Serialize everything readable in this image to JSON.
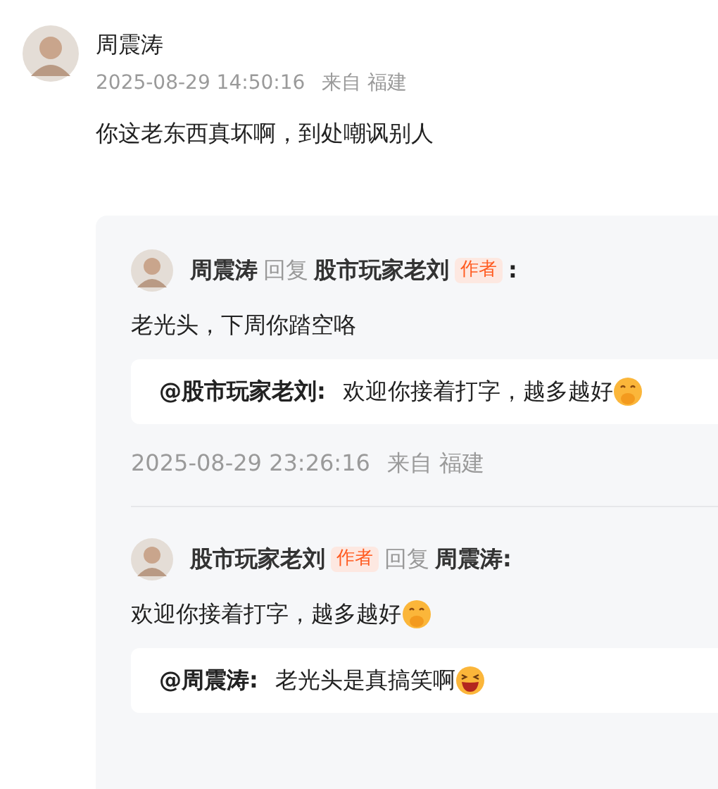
{
  "comment": {
    "author": "周震涛",
    "time": "2025-08-29 14:50:16",
    "location": "来自 福建",
    "content": "你这老东西真坏啊，到处嘲讽别人"
  },
  "replies": [
    {
      "header": [
        {
          "kind": "name",
          "text": "周震涛"
        },
        {
          "kind": "reply",
          "text": "回复"
        },
        {
          "kind": "name",
          "text": "股市玩家老刘"
        },
        {
          "kind": "badge",
          "text": "作者"
        },
        {
          "kind": "colon",
          "text": ":"
        }
      ],
      "content": "老光头，下周你踏空咯",
      "quote": {
        "mention": "@股市玩家老刘:",
        "text": "欢迎你接着打字，越多越好",
        "emoji": {
          "kind": "shy"
        }
      },
      "time": "2025-08-29 23:26:16",
      "location": "来自 福建"
    },
    {
      "header": [
        {
          "kind": "name",
          "text": "股市玩家老刘"
        },
        {
          "kind": "badge",
          "text": "作者"
        },
        {
          "kind": "reply",
          "text": "回复"
        },
        {
          "kind": "name",
          "text": "周震涛:"
        }
      ],
      "content": "欢迎你接着打字，越多越好",
      "content_emoji": {
        "kind": "shy"
      },
      "quote": {
        "mention": "@周震涛:",
        "text": "老光头是真搞笑啊",
        "emoji": {
          "kind": "laugh"
        }
      }
    }
  ]
}
